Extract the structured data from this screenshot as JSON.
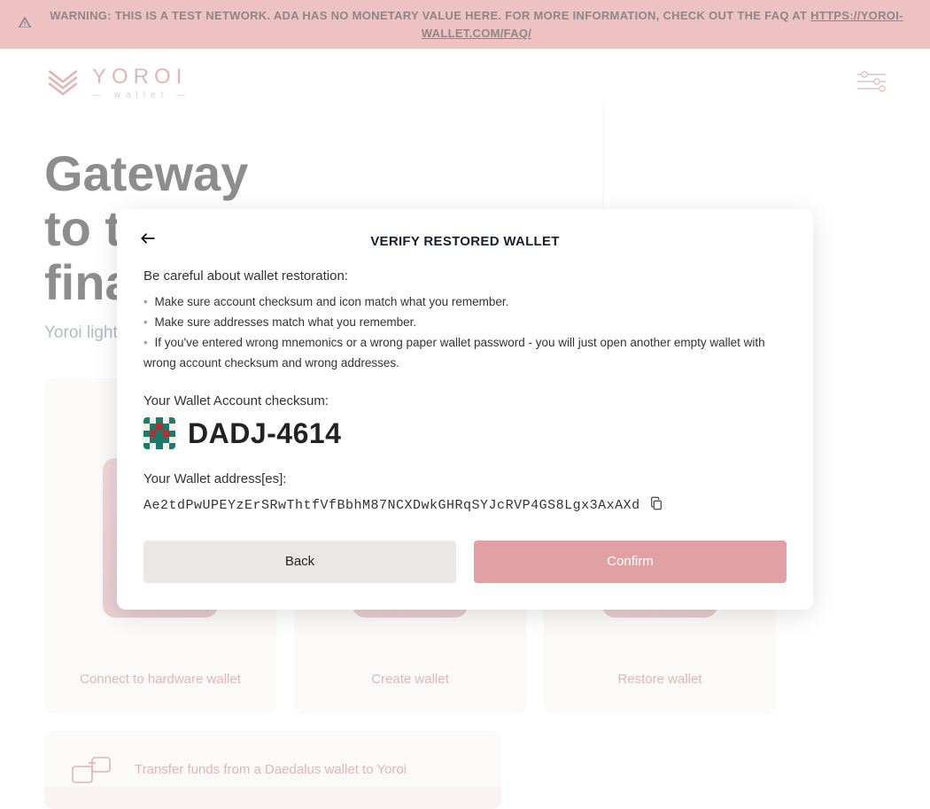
{
  "warning": {
    "text": "WARNING: THIS IS A TEST NETWORK. ADA HAS NO MONETARY VALUE HERE. FOR MORE INFORMATION, CHECK OUT THE FAQ AT",
    "faq_url": "HTTPS://YOROI-WALLET.COM/FAQ/"
  },
  "brand": {
    "name": "YOROI",
    "sub": "— wallet —"
  },
  "hero": {
    "title_line1": "Gateway",
    "title_line2": "to the",
    "title_line3": "financial world",
    "tagline": "Yoroi light wallet for Cardano assets"
  },
  "cards": [
    {
      "label": "Connect to hardware wallet"
    },
    {
      "label": "Create wallet"
    },
    {
      "label": "Restore wallet"
    }
  ],
  "transfer": {
    "label": "Transfer funds from a Daedalus wallet to Yoroi"
  },
  "dialog": {
    "title": "VERIFY RESTORED WALLET",
    "intro": "Be careful about wallet restoration:",
    "bullets": [
      "Make sure account checksum and icon match what you remember.",
      "Make sure addresses match what you remember.",
      "If you've entered wrong mnemonics or a wrong paper wallet password - you will just open another empty wallet with wrong account checksum and wrong addresses."
    ],
    "checksum_label": "Your Wallet Account checksum:",
    "checksum_value": "DADJ-4614",
    "address_label": "Your Wallet address[es]:",
    "address_value": "Ae2tdPwUPEYzErSRwThtfVfBbhM87NCXDwkGHRqSYJcRVP4GS8Lgx3AxAXd",
    "back_label": "Back",
    "confirm_label": "Confirm"
  },
  "colors": {
    "accent": "#c36b70",
    "primary_btn": "#e0a0a4",
    "secondary_btn": "#ece7e7",
    "banner": "#dc8287"
  },
  "identicon_colors": [
    "#1a7a6e",
    "#f5efe6",
    "#b62f2f"
  ]
}
